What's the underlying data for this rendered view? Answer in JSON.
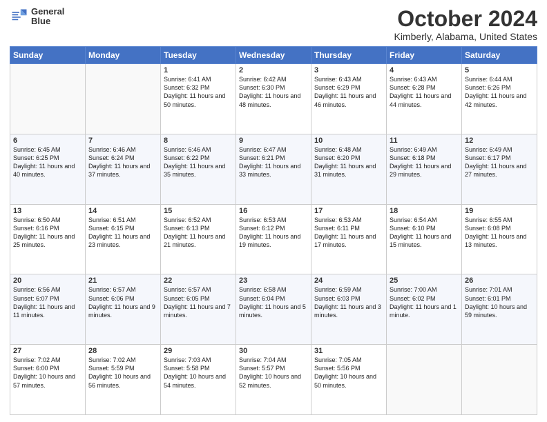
{
  "header": {
    "logo_line1": "General",
    "logo_line2": "Blue",
    "title": "October 2024",
    "subtitle": "Kimberly, Alabama, United States"
  },
  "days_header": [
    "Sunday",
    "Monday",
    "Tuesday",
    "Wednesday",
    "Thursday",
    "Friday",
    "Saturday"
  ],
  "weeks": [
    [
      {
        "day": "",
        "content": ""
      },
      {
        "day": "",
        "content": ""
      },
      {
        "day": "1",
        "content": "Sunrise: 6:41 AM\nSunset: 6:32 PM\nDaylight: 11 hours and 50 minutes."
      },
      {
        "day": "2",
        "content": "Sunrise: 6:42 AM\nSunset: 6:30 PM\nDaylight: 11 hours and 48 minutes."
      },
      {
        "day": "3",
        "content": "Sunrise: 6:43 AM\nSunset: 6:29 PM\nDaylight: 11 hours and 46 minutes."
      },
      {
        "day": "4",
        "content": "Sunrise: 6:43 AM\nSunset: 6:28 PM\nDaylight: 11 hours and 44 minutes."
      },
      {
        "day": "5",
        "content": "Sunrise: 6:44 AM\nSunset: 6:26 PM\nDaylight: 11 hours and 42 minutes."
      }
    ],
    [
      {
        "day": "6",
        "content": "Sunrise: 6:45 AM\nSunset: 6:25 PM\nDaylight: 11 hours and 40 minutes."
      },
      {
        "day": "7",
        "content": "Sunrise: 6:46 AM\nSunset: 6:24 PM\nDaylight: 11 hours and 37 minutes."
      },
      {
        "day": "8",
        "content": "Sunrise: 6:46 AM\nSunset: 6:22 PM\nDaylight: 11 hours and 35 minutes."
      },
      {
        "day": "9",
        "content": "Sunrise: 6:47 AM\nSunset: 6:21 PM\nDaylight: 11 hours and 33 minutes."
      },
      {
        "day": "10",
        "content": "Sunrise: 6:48 AM\nSunset: 6:20 PM\nDaylight: 11 hours and 31 minutes."
      },
      {
        "day": "11",
        "content": "Sunrise: 6:49 AM\nSunset: 6:18 PM\nDaylight: 11 hours and 29 minutes."
      },
      {
        "day": "12",
        "content": "Sunrise: 6:49 AM\nSunset: 6:17 PM\nDaylight: 11 hours and 27 minutes."
      }
    ],
    [
      {
        "day": "13",
        "content": "Sunrise: 6:50 AM\nSunset: 6:16 PM\nDaylight: 11 hours and 25 minutes."
      },
      {
        "day": "14",
        "content": "Sunrise: 6:51 AM\nSunset: 6:15 PM\nDaylight: 11 hours and 23 minutes."
      },
      {
        "day": "15",
        "content": "Sunrise: 6:52 AM\nSunset: 6:13 PM\nDaylight: 11 hours and 21 minutes."
      },
      {
        "day": "16",
        "content": "Sunrise: 6:53 AM\nSunset: 6:12 PM\nDaylight: 11 hours and 19 minutes."
      },
      {
        "day": "17",
        "content": "Sunrise: 6:53 AM\nSunset: 6:11 PM\nDaylight: 11 hours and 17 minutes."
      },
      {
        "day": "18",
        "content": "Sunrise: 6:54 AM\nSunset: 6:10 PM\nDaylight: 11 hours and 15 minutes."
      },
      {
        "day": "19",
        "content": "Sunrise: 6:55 AM\nSunset: 6:08 PM\nDaylight: 11 hours and 13 minutes."
      }
    ],
    [
      {
        "day": "20",
        "content": "Sunrise: 6:56 AM\nSunset: 6:07 PM\nDaylight: 11 hours and 11 minutes."
      },
      {
        "day": "21",
        "content": "Sunrise: 6:57 AM\nSunset: 6:06 PM\nDaylight: 11 hours and 9 minutes."
      },
      {
        "day": "22",
        "content": "Sunrise: 6:57 AM\nSunset: 6:05 PM\nDaylight: 11 hours and 7 minutes."
      },
      {
        "day": "23",
        "content": "Sunrise: 6:58 AM\nSunset: 6:04 PM\nDaylight: 11 hours and 5 minutes."
      },
      {
        "day": "24",
        "content": "Sunrise: 6:59 AM\nSunset: 6:03 PM\nDaylight: 11 hours and 3 minutes."
      },
      {
        "day": "25",
        "content": "Sunrise: 7:00 AM\nSunset: 6:02 PM\nDaylight: 11 hours and 1 minute."
      },
      {
        "day": "26",
        "content": "Sunrise: 7:01 AM\nSunset: 6:01 PM\nDaylight: 10 hours and 59 minutes."
      }
    ],
    [
      {
        "day": "27",
        "content": "Sunrise: 7:02 AM\nSunset: 6:00 PM\nDaylight: 10 hours and 57 minutes."
      },
      {
        "day": "28",
        "content": "Sunrise: 7:02 AM\nSunset: 5:59 PM\nDaylight: 10 hours and 56 minutes."
      },
      {
        "day": "29",
        "content": "Sunrise: 7:03 AM\nSunset: 5:58 PM\nDaylight: 10 hours and 54 minutes."
      },
      {
        "day": "30",
        "content": "Sunrise: 7:04 AM\nSunset: 5:57 PM\nDaylight: 10 hours and 52 minutes."
      },
      {
        "day": "31",
        "content": "Sunrise: 7:05 AM\nSunset: 5:56 PM\nDaylight: 10 hours and 50 minutes."
      },
      {
        "day": "",
        "content": ""
      },
      {
        "day": "",
        "content": ""
      }
    ]
  ]
}
